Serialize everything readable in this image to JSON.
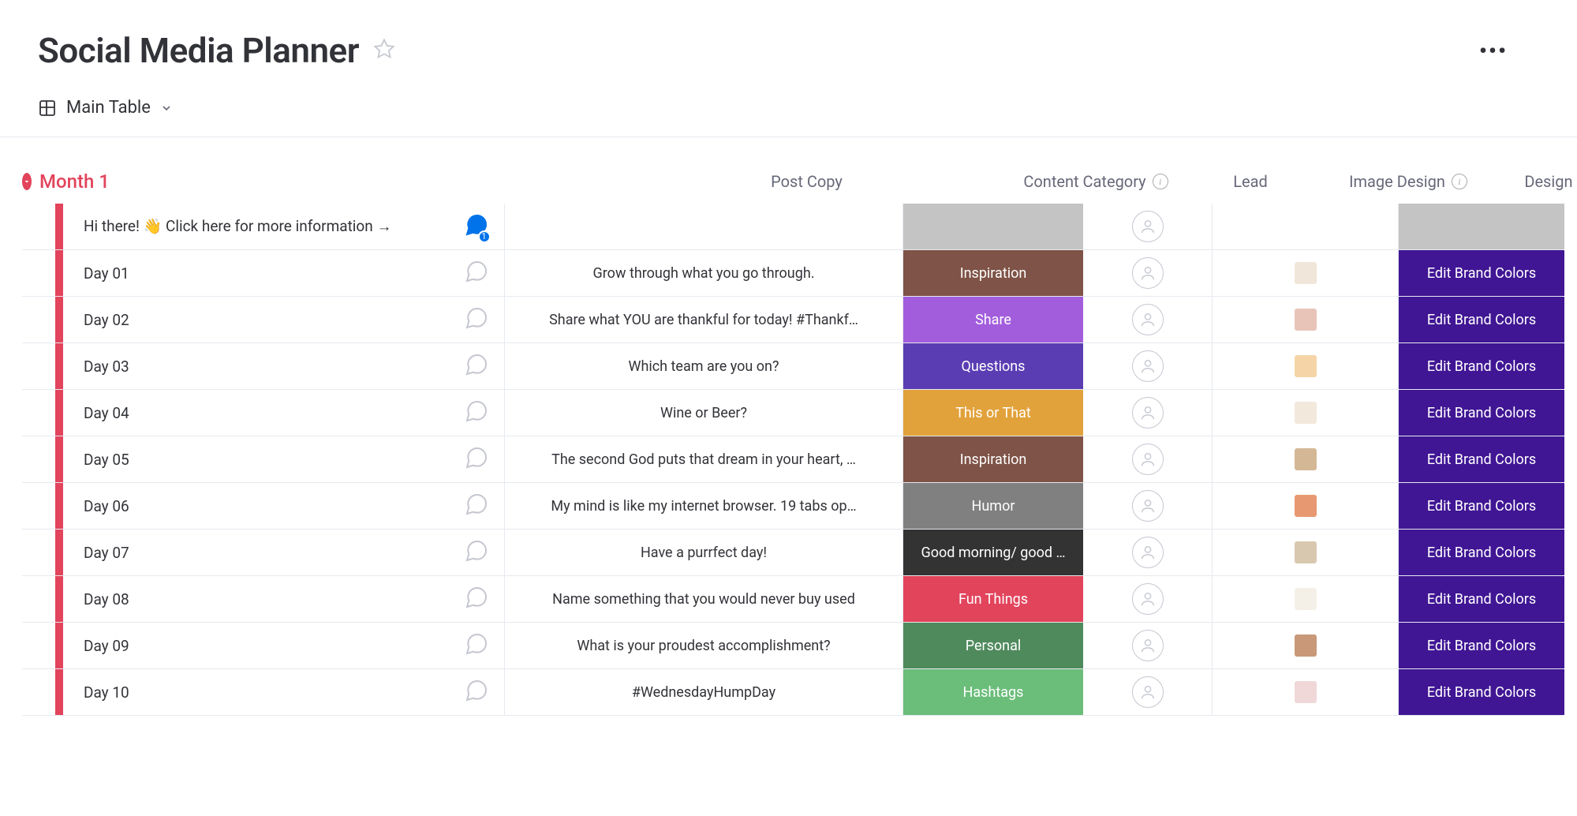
{
  "header": {
    "title": "Social Media Planner"
  },
  "view": {
    "name": "Main Table"
  },
  "group": {
    "title": "Month 1",
    "color": "#e2445c"
  },
  "columns": {
    "post_copy": "Post Copy",
    "content_category": "Content Category",
    "lead": "Lead",
    "image_design": "Image Design",
    "design_status": "Design Status"
  },
  "status": {
    "edit_brand_colors": "Edit Brand Colors",
    "color": "#401694"
  },
  "categories": {
    "inspiration": {
      "label": "Inspiration",
      "color": "#7f5347"
    },
    "share": {
      "label": "Share",
      "color": "#a25ddc"
    },
    "questions": {
      "label": "Questions",
      "color": "#5b3db3"
    },
    "this_or_that": {
      "label": "This or That",
      "color": "#e2a23b"
    },
    "humor": {
      "label": "Humor",
      "color": "#808080"
    },
    "good_morning": {
      "label": "Good morning/ good …",
      "color": "#333333"
    },
    "fun_things": {
      "label": "Fun Things",
      "color": "#e2445c"
    },
    "personal": {
      "label": "Personal",
      "color": "#4f8a5d"
    },
    "hashtags": {
      "label": "Hashtags",
      "color": "#6bbd7a"
    }
  },
  "rows": [
    {
      "name": "Hi there! 👋 Click here for more information →",
      "chat_active": true,
      "chat_count": "1",
      "post_copy": "",
      "category": null,
      "category_gray": true,
      "thumb": null,
      "status": null,
      "status_gray": true
    },
    {
      "name": "Day 01",
      "post_copy": "Grow through what you go through.",
      "category": "inspiration",
      "thumb": "#f0e6d9",
      "status": "edit_brand_colors"
    },
    {
      "name": "Day 02",
      "post_copy": "Share what YOU are thankful for today! #Thankf…",
      "category": "share",
      "thumb": "#e8c4b8",
      "status": "edit_brand_colors"
    },
    {
      "name": "Day 03",
      "post_copy": "Which team are you on?",
      "category": "questions",
      "thumb": "#f5d5a8",
      "status": "edit_brand_colors"
    },
    {
      "name": "Day 04",
      "post_copy": "Wine or Beer?",
      "category": "this_or_that",
      "thumb": "#f2e8dc",
      "status": "edit_brand_colors"
    },
    {
      "name": "Day 05",
      "post_copy": "The second God puts that dream in your heart, …",
      "category": "inspiration",
      "thumb": "#d4b896",
      "status": "edit_brand_colors"
    },
    {
      "name": "Day 06",
      "post_copy": "My mind is like my internet browser. 19 tabs op…",
      "category": "humor",
      "thumb": "#e89870",
      "status": "edit_brand_colors"
    },
    {
      "name": "Day 07",
      "post_copy": "Have a purrfect day!",
      "category": "good_morning",
      "thumb": "#d8c8b0",
      "status": "edit_brand_colors"
    },
    {
      "name": "Day 08",
      "post_copy": "Name something that you would never buy used",
      "category": "fun_things",
      "thumb": "#f4f0e8",
      "status": "edit_brand_colors"
    },
    {
      "name": "Day 09",
      "post_copy": "What is your proudest accomplishment?",
      "category": "personal",
      "thumb": "#c89878",
      "status": "edit_brand_colors"
    },
    {
      "name": "Day 10",
      "post_copy": "#WednesdayHumpDay",
      "category": "hashtags",
      "thumb": "#f0d8d8",
      "status": "edit_brand_colors"
    }
  ]
}
